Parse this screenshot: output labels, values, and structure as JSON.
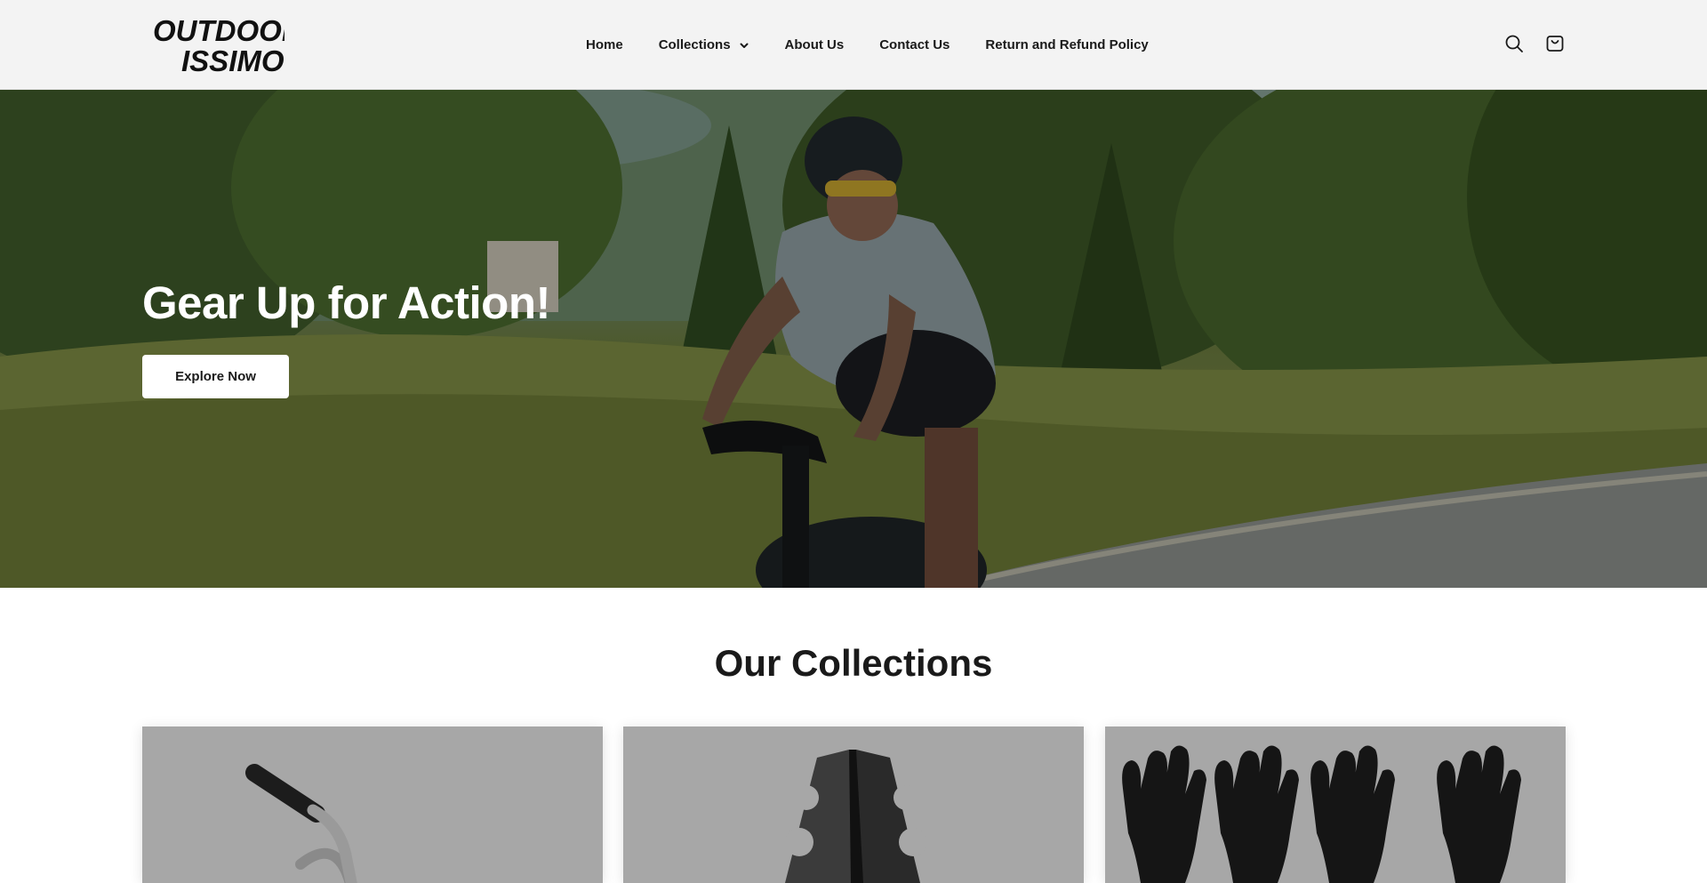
{
  "brand": {
    "name": "OUTDOOR ISSIMO",
    "logo_line1": "OUTDOOR",
    "logo_line2": "ISSIMO"
  },
  "nav": {
    "items": [
      {
        "label": "Home"
      },
      {
        "label": "Collections",
        "has_dropdown": true
      },
      {
        "label": "About Us"
      },
      {
        "label": "Contact Us"
      },
      {
        "label": "Return and Refund Policy"
      }
    ]
  },
  "header_icons": {
    "search": "search-icon",
    "cart": "cart-icon"
  },
  "hero": {
    "title": "Gear Up for Action!",
    "button_label": "Explore Now"
  },
  "collections": {
    "title": "Our Collections",
    "cards": [
      {
        "image": "bar-handle-product"
      },
      {
        "image": "dumbbell-rack-product"
      },
      {
        "image": "black-gloves-product"
      }
    ]
  },
  "colors": {
    "header_bg": "#f3f3f3",
    "text": "#1a1a1a",
    "button_bg": "#ffffff",
    "card_bg": "#a7a7a7"
  }
}
